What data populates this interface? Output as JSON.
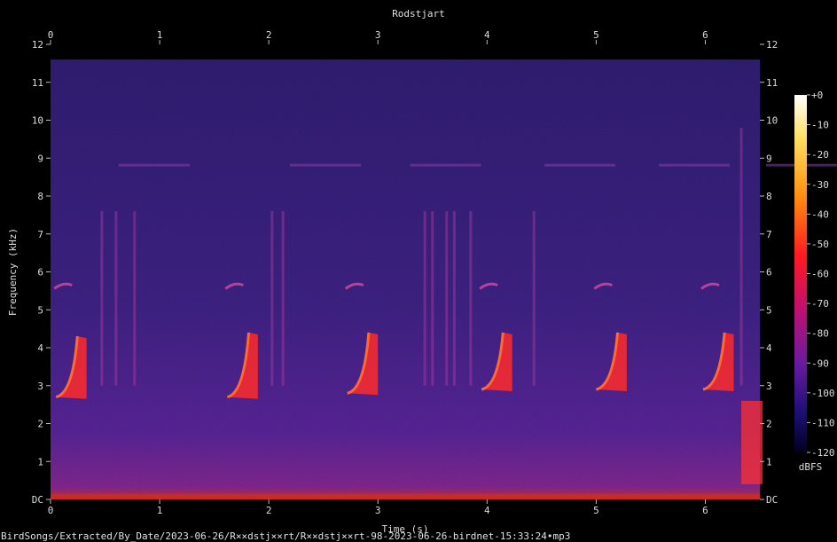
{
  "chart_data": {
    "type": "heatmap",
    "title": "Rodstjart",
    "xlabel": "Time (s)",
    "ylabel": "Frequency (kHz)",
    "xlim": [
      0,
      6.5
    ],
    "ylim": [
      0,
      12
    ],
    "x_ticks": [
      "0",
      "1",
      "2",
      "3",
      "4",
      "5",
      "6"
    ],
    "y_ticks": [
      "DC",
      "1",
      "2",
      "3",
      "4",
      "5",
      "6",
      "7",
      "8",
      "9",
      "10",
      "11",
      "12"
    ],
    "colorbar": {
      "label": "dBFS",
      "ticks": [
        "+0",
        "-10",
        "-20",
        "-30",
        "-40",
        "-50",
        "-60",
        "-70",
        "-80",
        "-90",
        "-100",
        "-110",
        "-120"
      ],
      "range": [
        -120,
        0
      ]
    },
    "colors": {
      "background": "#000000",
      "low": "#00003a",
      "mid": "#5a1f9a",
      "high": "#ff3020",
      "peak": "#ffffff"
    },
    "calls": [
      {
        "t": 0.05,
        "f_low": 2.7,
        "f_high": 4.3
      },
      {
        "t": 1.62,
        "f_low": 2.7,
        "f_high": 4.4
      },
      {
        "t": 2.72,
        "f_low": 2.8,
        "f_high": 4.4
      },
      {
        "t": 3.95,
        "f_low": 2.9,
        "f_high": 4.4
      },
      {
        "t": 5.0,
        "f_low": 2.9,
        "f_high": 4.4
      },
      {
        "t": 5.98,
        "f_low": 2.9,
        "f_high": 4.4
      }
    ],
    "max_frequency_band_khz": 11.6,
    "footer": "BirdSongs/Extracted/By_Date/2023-06-26/R××dstj××rt/R××dstj××rt-98-2023-06-26-birdnet-15:33:24•mp3"
  }
}
